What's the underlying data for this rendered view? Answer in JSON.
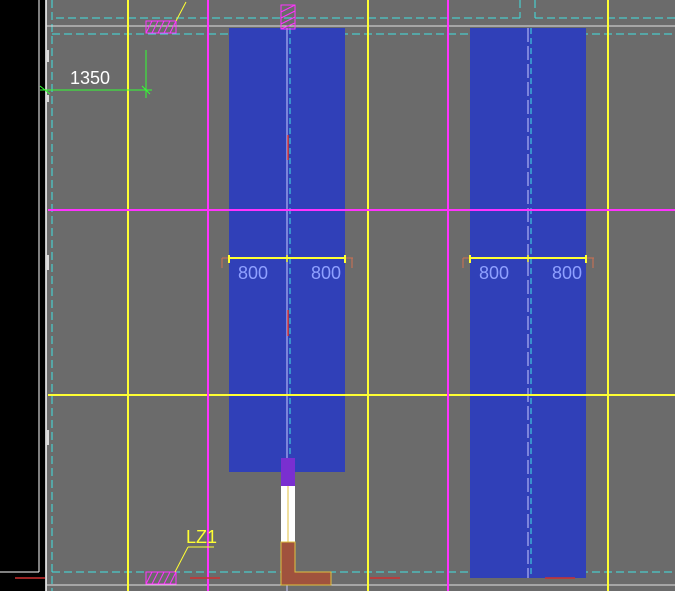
{
  "colors": {
    "background": "#6b6b6b",
    "left_panel": "#000000",
    "grid_yellow": "#ffff33",
    "grid_magenta": "#ff33ff",
    "column_blue": "#3040b8",
    "dashed_cyan": "#40e0e0",
    "dim_green": "#33ff33",
    "dim_text_blue": "#8fa0ff",
    "wall_brown": "#a0523d",
    "white": "#ffffff",
    "purple": "#7a2fd0"
  },
  "dimensions": {
    "left_offset": "1350",
    "col1_left": "800",
    "col1_right": "800",
    "col2_left": "800",
    "col2_right": "800"
  },
  "labels": {
    "beam_tag": "LZ1"
  }
}
